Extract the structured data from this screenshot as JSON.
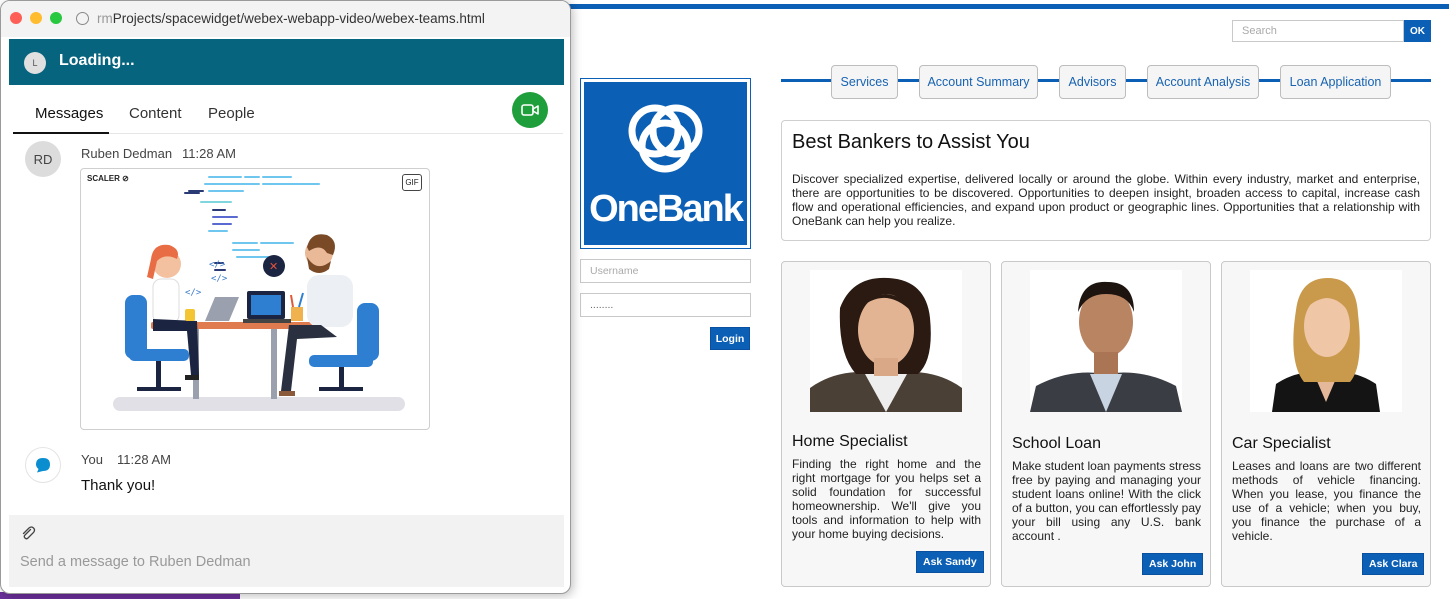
{
  "browser": {
    "url_faded_prefix": "rm",
    "url": "Projects/spacewidget/webex-webapp-video/webex-teams.html"
  },
  "webex": {
    "loading_avatar_initial": "L",
    "loading_text": "Loading...",
    "tabs": [
      {
        "label": "Messages",
        "active": true
      },
      {
        "label": "Content",
        "active": false
      },
      {
        "label": "People",
        "active": false
      }
    ],
    "messages": [
      {
        "avatar_initials": "RD",
        "sender": "Ruben Dedman",
        "time": "11:28 AM",
        "attachment": {
          "type": "gif",
          "badge": "GIF",
          "brand": "SCALER"
        }
      },
      {
        "avatar_icon": "chat-bubble-icon",
        "sender": "You",
        "time": "11:28 AM",
        "text": "Thank you!"
      }
    ],
    "composer_placeholder": "Send a message to Ruben Dedman",
    "colors": {
      "header": "#07647f",
      "meet_button": "#1f9e3c"
    }
  },
  "bank": {
    "search_placeholder": "Search",
    "search_button": "OK",
    "nav": [
      "Services",
      "Account Summary",
      "Advisors",
      "Account Analysis",
      "Loan Application"
    ],
    "logo_text": "OneBank",
    "username_placeholder": "Username",
    "password_value": "........",
    "login_button": "Login",
    "intro_title": "Best Bankers to Assist You",
    "intro_text": "Discover specialized expertise, delivered locally or around the globe. Within every industry, market and enterprise, there are opportunities to be discovered. Opportunities to deepen insight, broaden access to capital, increase cash flow and operational efficiencies, and expand upon product or geographic lines. Opportunities that a relationship with OneBank can help you realize.",
    "cards": [
      {
        "title": "Home Specialist",
        "text": "Finding the right home and the right mortgage for you helps set a solid foundation for successful homeownership. We'll give you tools and information to help with your home buying decisions.",
        "button": "Ask Sandy"
      },
      {
        "title": "School Loan",
        "text": "Make student loan payments stress free by paying and managing your student loans online! With the click of a button, you can effortlessly pay your bill using any U.S. bank account .",
        "button": "Ask John"
      },
      {
        "title": "Car Specialist",
        "text": "Leases and loans are two different methods of vehicle financing. When you lease, you finance the use of a vehicle; when you buy, you finance the purchase of a vehicle.",
        "button": "Ask Clara"
      }
    ],
    "colors": {
      "brand": "#0b5fb5"
    }
  }
}
